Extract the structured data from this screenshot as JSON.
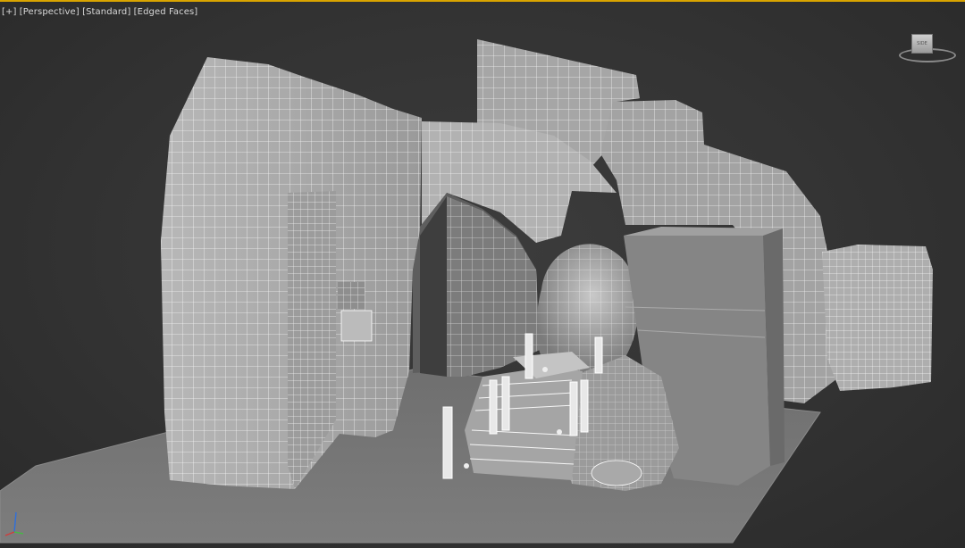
{
  "viewport": {
    "plus_label": "[+]",
    "view_label": "[Perspective]",
    "shading_label": "[Standard]",
    "display_label": "[Edged Faces]"
  },
  "viewcube": {
    "face_label": "SIDE"
  },
  "colors": {
    "active_border": "#d9a400",
    "background": "#333333",
    "mesh_edge": "#ffffff",
    "ground": "#777777"
  },
  "icons": {
    "viewcube": "viewcube-icon",
    "axis": "axis-tripod-icon"
  }
}
